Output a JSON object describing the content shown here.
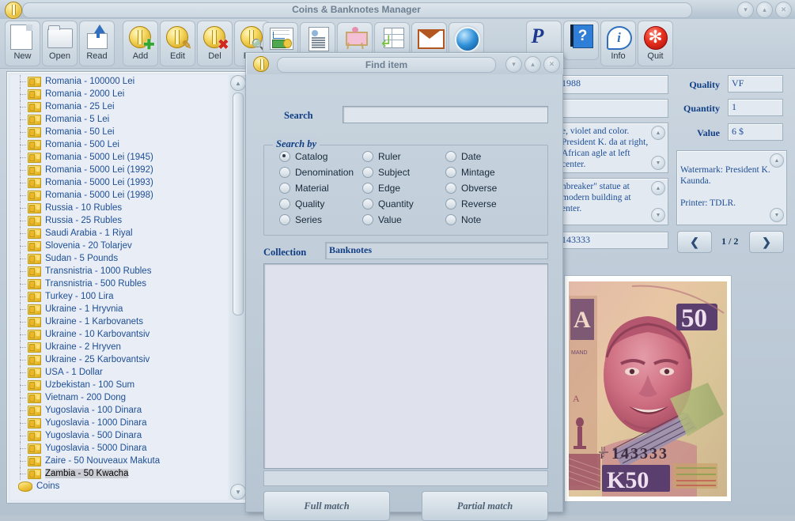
{
  "window": {
    "title": "Coins & Banknotes Manager",
    "controls": [
      {
        "name": "minimize",
        "glyph": "▾"
      },
      {
        "name": "maximize",
        "glyph": "▴"
      },
      {
        "name": "close",
        "glyph": "✕"
      }
    ]
  },
  "toolbar": {
    "main_buttons": [
      {
        "label": "New",
        "icon": "new-page-icon",
        "accel": "N"
      },
      {
        "label": "Open",
        "icon": "open-folder-icon",
        "accel": "O"
      },
      {
        "label": "Read",
        "icon": "read-import-icon",
        "accel": "R"
      }
    ],
    "item_buttons": [
      {
        "label": "Add",
        "icon": "coin-plus-icon"
      },
      {
        "label": "Edit",
        "icon": "coin-pencil-icon"
      },
      {
        "label": "Del",
        "icon": "coin-delete-icon"
      },
      {
        "label": "Find",
        "icon": "coin-search-icon"
      }
    ],
    "tool_buttons": [
      {
        "label": "",
        "icon": "statistics-money-icon"
      },
      {
        "label": "",
        "icon": "report-document-icon"
      },
      {
        "label": "",
        "icon": "exhibition-easel-icon"
      },
      {
        "label": "",
        "icon": "export-table-icon"
      },
      {
        "label": "",
        "icon": "mail-envelope-icon"
      },
      {
        "label": "",
        "icon": "internet-globe-icon"
      }
    ],
    "right_buttons": [
      {
        "label": "",
        "icon": "paypal-icon"
      },
      {
        "label": "",
        "icon": "help-book-icon"
      },
      {
        "label": "Info",
        "icon": "info-icon"
      },
      {
        "label": "Quit",
        "icon": "quit-icon"
      }
    ]
  },
  "sidebar": {
    "items": [
      {
        "label": "Romania - 100000 Lei",
        "icon": "banknote-icon",
        "selected": false
      },
      {
        "label": "Romania - 2000 Lei",
        "icon": "banknote-icon",
        "selected": false
      },
      {
        "label": "Romania - 25 Lei",
        "icon": "banknote-icon",
        "selected": false
      },
      {
        "label": "Romania - 5 Lei",
        "icon": "banknote-icon",
        "selected": false
      },
      {
        "label": "Romania - 50 Lei",
        "icon": "banknote-icon",
        "selected": false
      },
      {
        "label": "Romania - 500 Lei",
        "icon": "banknote-icon",
        "selected": false
      },
      {
        "label": "Romania - 5000 Lei (1945)",
        "icon": "banknote-icon",
        "selected": false
      },
      {
        "label": "Romania - 5000 Lei (1992)",
        "icon": "banknote-icon",
        "selected": false
      },
      {
        "label": "Romania - 5000 Lei (1993)",
        "icon": "banknote-icon",
        "selected": false
      },
      {
        "label": "Romania - 5000 Lei (1998)",
        "icon": "banknote-icon",
        "selected": false
      },
      {
        "label": "Russia - 10 Rubles",
        "icon": "banknote-icon",
        "selected": false
      },
      {
        "label": "Russia - 25 Rubles",
        "icon": "banknote-icon",
        "selected": false
      },
      {
        "label": "Saudi Arabia - 1 Riyal",
        "icon": "banknote-icon",
        "selected": false
      },
      {
        "label": "Slovenia - 20 Tolarjev",
        "icon": "banknote-icon",
        "selected": false
      },
      {
        "label": "Sudan - 5 Pounds",
        "icon": "banknote-icon",
        "selected": false
      },
      {
        "label": "Transnistria - 1000 Rubles",
        "icon": "banknote-icon",
        "selected": false
      },
      {
        "label": "Transnistria - 500 Rubles",
        "icon": "banknote-icon",
        "selected": false
      },
      {
        "label": "Turkey - 100 Lira",
        "icon": "banknote-icon",
        "selected": false
      },
      {
        "label": "Ukraine - 1 Hryvnia",
        "icon": "banknote-icon",
        "selected": false
      },
      {
        "label": "Ukraine - 1 Karbovanets",
        "icon": "banknote-icon",
        "selected": false
      },
      {
        "label": "Ukraine - 10 Karbovantsiv",
        "icon": "banknote-icon",
        "selected": false
      },
      {
        "label": "Ukraine - 2 Hryven",
        "icon": "banknote-icon",
        "selected": false
      },
      {
        "label": "Ukraine - 25 Karbovantsiv",
        "icon": "banknote-icon",
        "selected": false
      },
      {
        "label": "USA - 1 Dollar",
        "icon": "banknote-icon",
        "selected": false
      },
      {
        "label": "Uzbekistan - 100 Sum",
        "icon": "banknote-icon",
        "selected": false
      },
      {
        "label": "Vietnam - 200 Dong",
        "icon": "banknote-icon",
        "selected": false
      },
      {
        "label": "Yugoslavia - 100 Dinara",
        "icon": "banknote-icon",
        "selected": false
      },
      {
        "label": "Yugoslavia - 1000 Dinara",
        "icon": "banknote-icon",
        "selected": false
      },
      {
        "label": "Yugoslavia - 500 Dinara",
        "icon": "banknote-icon",
        "selected": false
      },
      {
        "label": "Yugoslavia - 5000 Dinara",
        "icon": "banknote-icon",
        "selected": false
      },
      {
        "label": "Zaire - 50 Nouveaux Makuta",
        "icon": "banknote-icon",
        "selected": false
      },
      {
        "label": "Zambia - 50 Kwacha",
        "icon": "banknote-icon",
        "selected": true
      }
    ],
    "root": {
      "label": "Coins",
      "icon": "coins-icon"
    }
  },
  "find_dialog": {
    "title": "Find item",
    "search_label": "Search",
    "search_value": "",
    "group_label": "Search by",
    "radios": [
      {
        "label": "Catalog",
        "checked": true
      },
      {
        "label": "Ruler",
        "checked": false
      },
      {
        "label": "Date",
        "checked": false
      },
      {
        "label": "Denomination",
        "checked": false
      },
      {
        "label": "Subject",
        "checked": false
      },
      {
        "label": "Mintage",
        "checked": false
      },
      {
        "label": "Material",
        "checked": false
      },
      {
        "label": "Edge",
        "checked": false
      },
      {
        "label": "Obverse",
        "checked": false
      },
      {
        "label": "Quality",
        "checked": false
      },
      {
        "label": "Quantity",
        "checked": false
      },
      {
        "label": "Reverse",
        "checked": false
      },
      {
        "label": "Series",
        "checked": false
      },
      {
        "label": "Value",
        "checked": false
      },
      {
        "label": "Note",
        "checked": false
      }
    ],
    "collection_label": "Collection",
    "collection_value": "Banknotes",
    "results": [],
    "status_text": "",
    "full_match_label": "Full match",
    "partial_match_label": "Partial match",
    "controls": [
      {
        "name": "minimize",
        "glyph": "▾"
      },
      {
        "name": "maximize",
        "glyph": "▴"
      },
      {
        "name": "close",
        "glyph": "✕"
      }
    ]
  },
  "details": {
    "year_value": "1988",
    "blank_value": "",
    "description_value": "e, violet and color. President K. da at right, African agle at left center.",
    "reverse_value": "nbreaker\" statue at modern building at enter.",
    "serial_value": "143333",
    "quality_label": "Quality",
    "quality_value": "VF",
    "quantity_label": "Quantity",
    "quantity_value": "1",
    "value_label": "Value",
    "value_value": "6 $",
    "note_value": "Watermark: President K. Kaunda.\n\nPrinter: TDLR.",
    "pager_text": "1 / 2",
    "prev_glyph": "❮",
    "next_glyph": "❯",
    "image_alt": "Zambia 50 Kwacha banknote obverse"
  }
}
